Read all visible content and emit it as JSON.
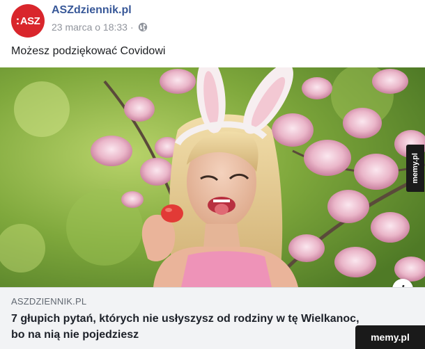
{
  "post": {
    "avatar_text": "ASZ",
    "page_name": "ASZdziennik.pl",
    "timestamp": "23 marca o 18:33",
    "separator": "·",
    "privacy_icon": "globe-icon",
    "text": "Możesz podziękować Covidowi"
  },
  "link": {
    "domain": "ASZDZIENNIK.PL",
    "title": "7 głupich pytań, których nie usłyszysz od rodziny w tę Wielkanoc, bo na nią nie pojedziesz",
    "info_icon": "i"
  },
  "watermark": {
    "side": "memy.pl",
    "bottom": "memy.pl"
  },
  "colors": {
    "brand_red": "#d9262c",
    "link_blue": "#385898",
    "caption_bg": "#f2f3f5"
  }
}
